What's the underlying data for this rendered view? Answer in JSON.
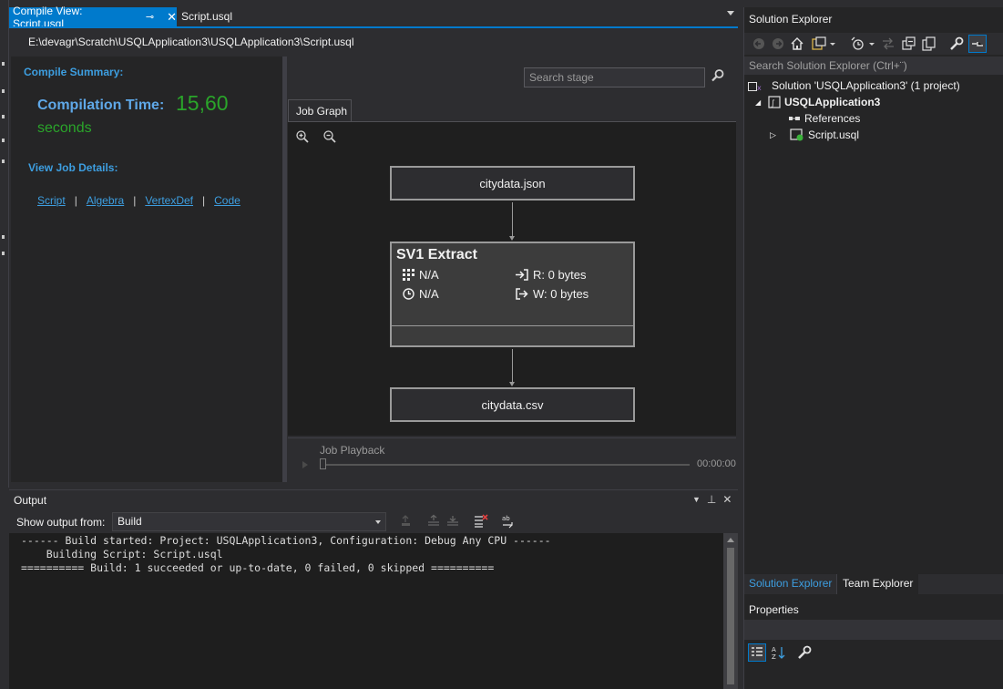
{
  "tabs": {
    "active_label": "Compile View: Script.usql",
    "inactive_label": "Script.usql"
  },
  "document": {
    "path": "E:\\devagr\\Scratch\\USQLApplication3\\USQLApplication3\\Script.usql"
  },
  "summary": {
    "heading": "Compile Summary:",
    "compilation_time_label": "Compilation Time:",
    "compilation_time_value": "15,60",
    "compilation_time_unit": "seconds",
    "details_heading": "View Job Details:",
    "links": [
      "Script",
      "Algebra",
      "VertexDef",
      "Code"
    ],
    "link_separator": "|"
  },
  "job_graph": {
    "search_placeholder": "Search stage",
    "tab_label": "Job Graph",
    "input_node": "citydata.json",
    "output_node": "citydata.csv",
    "stage": {
      "title": "SV1 Extract",
      "vertices": "N/A",
      "time": "N/A",
      "read": "R: 0 bytes",
      "write": "W: 0 bytes"
    },
    "playback_label": "Job Playback",
    "playback_time": "00:00:00"
  },
  "output": {
    "title": "Output",
    "show_from_label": "Show output from:",
    "show_from_value": "Build",
    "lines": [
      "------ Build started: Project: USQLApplication3, Configuration: Debug Any CPU ------",
      "    Building Script: Script.usql",
      "========== Build: 1 succeeded or up-to-date, 0 failed, 0 skipped =========="
    ]
  },
  "solution_explorer": {
    "title": "Solution Explorer",
    "search_placeholder": "Search Solution Explorer (Ctrl+¨)",
    "tree": {
      "solution": "Solution 'USQLApplication3' (1 project)",
      "project": "USQLApplication3",
      "references": "References",
      "script": "Script.usql"
    },
    "bottom_tabs": [
      "Solution Explorer",
      "Team Explorer"
    ]
  },
  "properties": {
    "title": "Properties"
  },
  "colors": {
    "accent": "#007acc",
    "link": "#3d9ee0",
    "success": "#2aa52a",
    "background": "#2d2d30"
  }
}
